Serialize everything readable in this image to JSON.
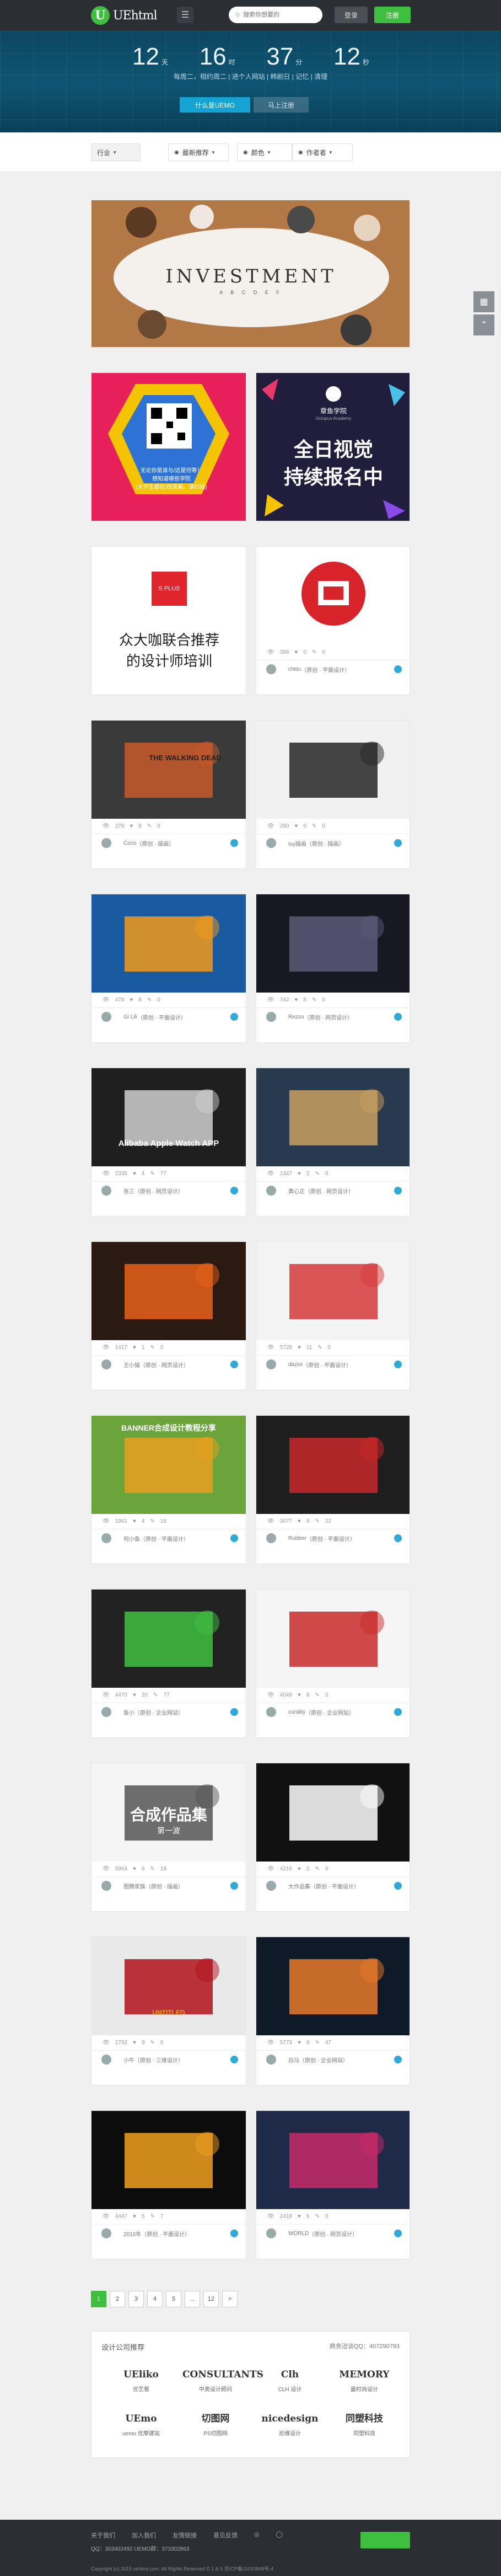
{
  "header": {
    "logo_text": "UEhtml",
    "search_placeholder": "搜索你想要的",
    "login": "登录",
    "register": "注册"
  },
  "hero": {
    "counts": [
      {
        "num": "12",
        "unit": "天"
      },
      {
        "num": "16",
        "unit": "时"
      },
      {
        "num": "37",
        "unit": "分"
      },
      {
        "num": "12",
        "unit": "秒"
      }
    ],
    "subtitle": "每周二，相约周二 | 进个人网站 | 韩剧日 | 记忆 | 清理",
    "primary_btn": "什么是UEMO",
    "secondary_btn": "马上注册"
  },
  "filters": [
    {
      "label": "行业",
      "icon": "▾"
    },
    {
      "label": "最新推荐",
      "icon": "●"
    },
    {
      "label": "颜色",
      "icon": "●"
    },
    {
      "label": "作者者",
      "icon": "●"
    }
  ],
  "side_tools": [
    "grid-icon",
    "arrow-up-icon"
  ],
  "banner": {
    "title": "INVESTMENT",
    "subtitle": "A B C D E F"
  },
  "promo1": {
    "text": "无论你是谁与/这是何等！\n想知道哪些学院\n(大学生都在/找答案。请扫描)"
  },
  "promo2": {
    "school": "章鱼学院",
    "school_en": "Octopus Academy",
    "line1": "全日视觉",
    "line2": "持续报名中"
  },
  "card3": {
    "tag": "S PLUS",
    "text": "众大咖联合推荐的设计师培训"
  },
  "cards": [
    {
      "views": "398",
      "likes": "0",
      "comments": "0",
      "author": "chitiu",
      "tag": "（原创 · 平面设计）"
    },
    {
      "views": "278",
      "likes": "8",
      "comments": "0",
      "author": "Coco",
      "tag": "（原创 · 插画）"
    },
    {
      "views": "290",
      "likes": "9",
      "comments": "0",
      "author": "Ivy插画",
      "tag": "（原创 · 插画）"
    },
    {
      "views": "479",
      "likes": "8",
      "comments": "0",
      "author": "Gi Lili",
      "tag": "（原创 · 平面设计）"
    },
    {
      "views": "742",
      "likes": "8",
      "comments": "0",
      "author": "Rezzo",
      "tag": "（原创 · 网页设计）"
    },
    {
      "views": "2335",
      "likes": "4",
      "comments": "77",
      "author": "张三",
      "tag": "（原创 · 网页设计）"
    },
    {
      "views": "1347",
      "likes": "2",
      "comments": "0",
      "author": "黄心正",
      "tag": "（原创 · 网页设计）"
    },
    {
      "views": "1417",
      "likes": "1",
      "comments": "0",
      "author": "王小猫",
      "tag": "（原创 · 网页设计）"
    },
    {
      "views": "5728",
      "likes": "11",
      "comments": "0",
      "author": "dazini",
      "tag": "（原创 · 平面设计）"
    },
    {
      "views": "1961",
      "likes": "4",
      "comments": "16",
      "author": "何小鱼",
      "tag": "（原创 · 平面设计）"
    },
    {
      "views": "3077",
      "likes": "8",
      "comments": "22",
      "author": "Rubber",
      "tag": "（原创 · 平面设计）"
    },
    {
      "views": "4470",
      "likes": "20",
      "comments": "77",
      "author": "鱼小",
      "tag": "（原创 · 企业网站）"
    },
    {
      "views": "4049",
      "likes": "8",
      "comments": "0",
      "author": "coralily",
      "tag": "（原创 · 企业网站）"
    },
    {
      "views": "5963",
      "likes": "6",
      "comments": "18",
      "author": "图腾家族",
      "tag": "（原创 · 插画）"
    },
    {
      "views": "4216",
      "likes": "2",
      "comments": "0",
      "author": "大作品集",
      "tag": "（原创 · 平面设计）"
    },
    {
      "views": "2752",
      "likes": "9",
      "comments": "0",
      "author": "小牛",
      "tag": "（原创 · 三维设计）"
    },
    {
      "views": "5773",
      "likes": "8",
      "comments": "47",
      "author": "白马",
      "tag": "（原创 · 企业网站）"
    },
    {
      "views": "4447",
      "likes": "5",
      "comments": "7",
      "author": "2016年",
      "tag": "（原创 · 平面设计）"
    },
    {
      "views": "2418",
      "likes": "6",
      "comments": "0",
      "author": "WORLD",
      "tag": "（原创 · 网页设计）"
    }
  ],
  "card_texts": {
    "alibaba": "Alibaba Apple Watch APP",
    "banner_tut": "BANNER合成设计教程分享",
    "compose": "合成作品集",
    "compose2": "第一波",
    "untitled": "UNTITLED",
    "walking": "THE WALKING DEAD"
  },
  "pager": [
    "1",
    "2",
    "3",
    "4",
    "5",
    "...",
    "12",
    ">"
  ],
  "partners": {
    "title": "设计公司推荐",
    "contact": "商务洽谈QQ：407290793",
    "items": [
      "优艺客",
      "中奥设计顾问",
      "CLH 设计",
      "最时尚设计",
      "uemo 优摩建站",
      "PS切图网",
      "尼维设计",
      "同塑科技"
    ],
    "logos": [
      "UEliko",
      "CONSULTANTS",
      "Clh",
      "MEMORY",
      "UEmo",
      "切图网",
      "nicedesign",
      "同塑科技"
    ]
  },
  "footer": {
    "links": [
      "关于我们",
      "加入我们",
      "友情链接",
      "意见反馈"
    ],
    "info": "QQ：303402492    UEMO群：373302863",
    "copyright": "Copyright (c) 2015 uehtml.com. All Rights Reserved © 1 & 5 京ICP备11010848号-4"
  }
}
